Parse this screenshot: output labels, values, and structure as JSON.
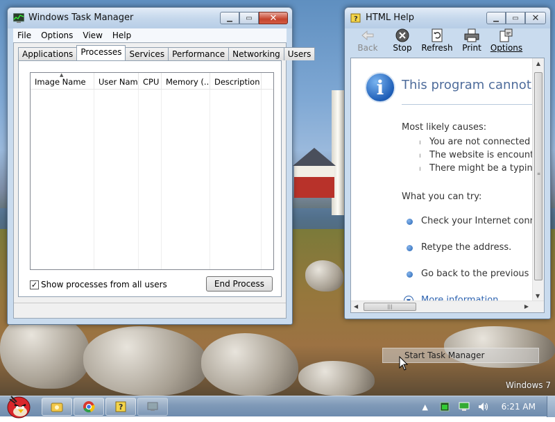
{
  "desktop": {
    "watermark": "Windows 7"
  },
  "task_manager": {
    "title": "Windows Task Manager",
    "menu": [
      "File",
      "Options",
      "View",
      "Help"
    ],
    "tabs": [
      {
        "label": "Applications",
        "active": false
      },
      {
        "label": "Processes",
        "active": true
      },
      {
        "label": "Services",
        "active": false
      },
      {
        "label": "Performance",
        "active": false
      },
      {
        "label": "Networking",
        "active": false
      },
      {
        "label": "Users",
        "active": false
      }
    ],
    "columns": [
      "Image Name",
      "User Name",
      "CPU",
      "Memory (...",
      "Description"
    ],
    "rows": [],
    "show_all_users_label": "Show processes from all users",
    "show_all_users_checked": true,
    "end_process_label": "End Process"
  },
  "html_help": {
    "title": "HTML Help",
    "toolbar": [
      {
        "label": "Back",
        "icon": "back-arrow-icon",
        "enabled": false
      },
      {
        "label": "Stop",
        "icon": "stop-icon",
        "enabled": true
      },
      {
        "label": "Refresh",
        "icon": "refresh-icon",
        "enabled": true
      },
      {
        "label": "Print",
        "icon": "printer-icon",
        "enabled": true
      },
      {
        "label": "Options",
        "icon": "options-icon",
        "enabled": true
      }
    ],
    "heading": "This program cannot dis",
    "causes_title": "Most likely causes:",
    "causes": [
      "You are not connected to",
      "The website is encounter",
      "There might be a typing"
    ],
    "try_title": "What you can try:",
    "tries": [
      "Check your Internet conne",
      "Retype the address.",
      "Go back to the previous pa"
    ],
    "more_info": "More information",
    "accent": "#4e6c9b"
  },
  "tooltip": {
    "text": "Start Task Manager"
  },
  "taskbar": {
    "clock": "6:21 AM"
  }
}
